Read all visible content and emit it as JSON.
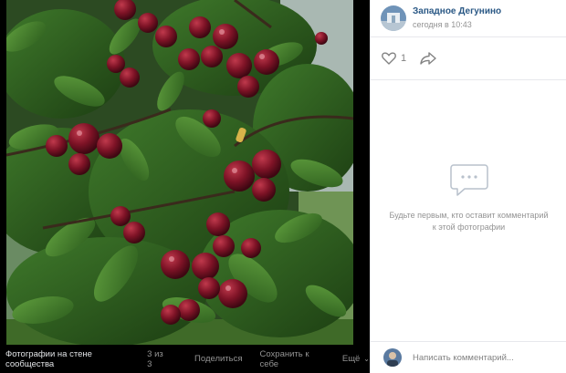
{
  "viewer": {
    "album_title": "Фотографии на стене сообщества",
    "counter": "3 из 3",
    "share_label": "Поделиться",
    "save_label": "Сохранить к себе",
    "more_label": "Ещё"
  },
  "post": {
    "group_name": "Западное Дегунино",
    "time": "сегодня в 10:43",
    "like_count": "1"
  },
  "comments": {
    "empty_text": "Будьте первым, кто оставит комментарий к этой фотографии",
    "input_placeholder": "Написать комментарий..."
  },
  "colors": {
    "link": "#2a5885",
    "muted": "#939393",
    "divider": "#e7e8ec",
    "viewer_bg": "#000000"
  },
  "icons": {
    "like": "heart-outline-icon",
    "share": "share-arrow-icon",
    "empty_comments": "speech-bubble-icon",
    "more": "chevron-down-icon"
  }
}
